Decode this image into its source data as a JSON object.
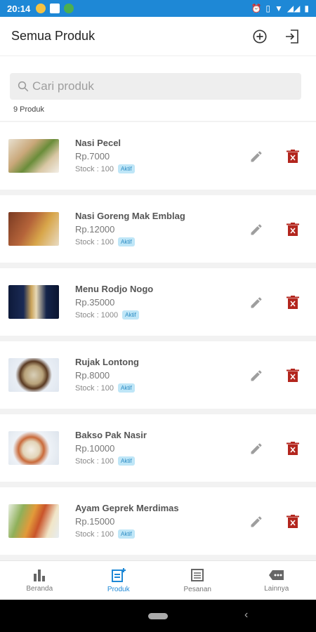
{
  "status": {
    "time": "20:14"
  },
  "appbar": {
    "title": "Semua Produk",
    "add_icon": "add-circle-icon",
    "exit_icon": "exit-icon"
  },
  "search": {
    "placeholder": "Cari produk",
    "value": ""
  },
  "count_text": "9 Produk",
  "products": [
    {
      "name": "Nasi Pecel",
      "price": "Rp.7000",
      "stock": "Stock : 100",
      "status": "Aktif"
    },
    {
      "name": "Nasi Goreng Mak Emblag",
      "price": "Rp.12000",
      "stock": "Stock : 100",
      "status": "Aktif"
    },
    {
      "name": "Menu Rodjo Nogo",
      "price": "Rp.35000",
      "stock": "Stock : 1000",
      "status": "Aktif"
    },
    {
      "name": "Rujak Lontong",
      "price": "Rp.8000",
      "stock": "Stock : 100",
      "status": "Aktif"
    },
    {
      "name": "Bakso Pak Nasir",
      "price": "Rp.10000",
      "stock": "Stock : 100",
      "status": "Aktif"
    },
    {
      "name": "Ayam Geprek Merdimas",
      "price": "Rp.15000",
      "stock": "Stock : 100",
      "status": "Aktif"
    }
  ],
  "nav": [
    {
      "label": "Beranda",
      "icon": "bar-chart-icon"
    },
    {
      "label": "Produk",
      "icon": "add-product-icon"
    },
    {
      "label": "Pesanan",
      "icon": "list-icon"
    },
    {
      "label": "Lainnya",
      "icon": "more-icon"
    }
  ],
  "colors": {
    "primary": "#1e88d6",
    "delete": "#b3261e",
    "badge_bg": "#bfe6f7"
  }
}
